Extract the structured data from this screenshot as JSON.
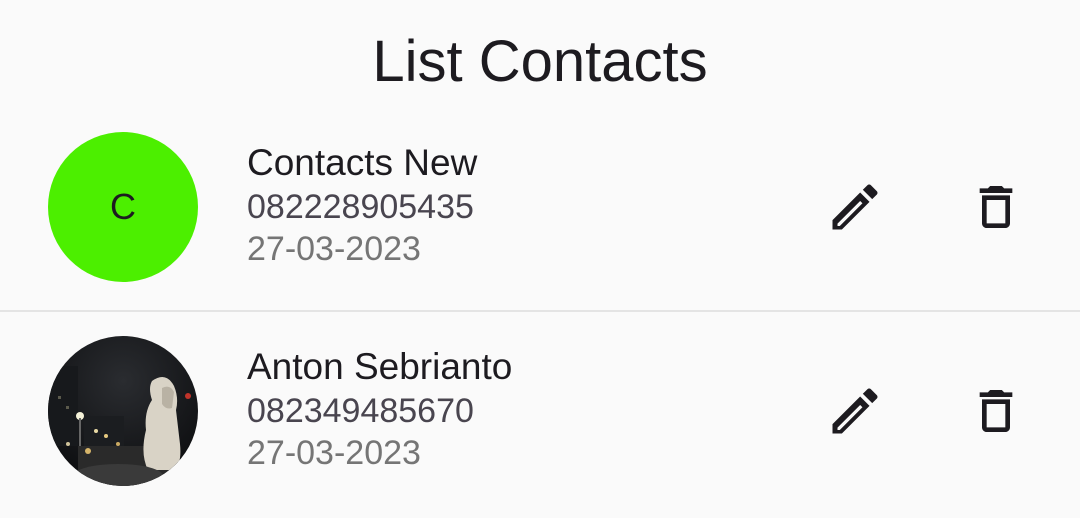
{
  "header": {
    "title": "List Contacts"
  },
  "contacts": [
    {
      "avatar_letter": "C",
      "avatar_color": "#4cef00",
      "name": "Contacts New",
      "phone": "082228905435",
      "date": "27-03-2023",
      "edit_icon": "pencil-icon",
      "delete_icon": "trash-icon"
    },
    {
      "avatar_type": "photo",
      "name": "Anton Sebrianto",
      "phone": "082349485670",
      "date": "27-03-2023",
      "edit_icon": "pencil-icon",
      "delete_icon": "trash-icon"
    }
  ]
}
